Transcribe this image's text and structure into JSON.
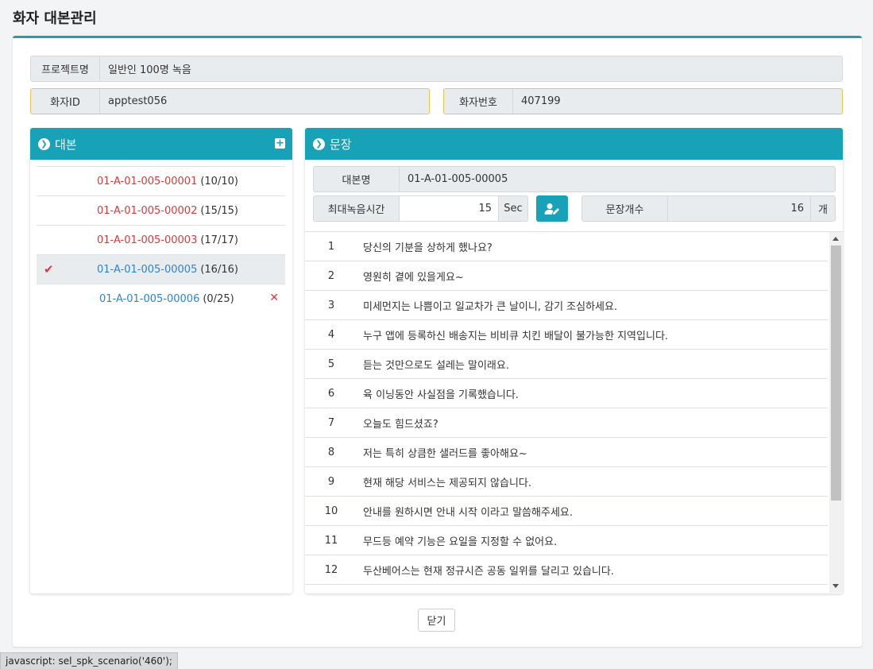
{
  "page": {
    "title": "화자 대본관리"
  },
  "info": {
    "project_label": "프로젝트명",
    "project_value": "일반인 100명 녹음",
    "speaker_id_label": "화자ID",
    "speaker_id_value": "apptest056",
    "speaker_no_label": "화자번호",
    "speaker_no_value": "407199"
  },
  "scripts_panel": {
    "title": "대본",
    "items": [
      {
        "code": "01-A-01-005-00001",
        "count": "(10/10)",
        "color": "red",
        "selected": false,
        "deletable": false
      },
      {
        "code": "01-A-01-005-00002",
        "count": "(15/15)",
        "color": "red",
        "selected": false,
        "deletable": false
      },
      {
        "code": "01-A-01-005-00003",
        "count": "(17/17)",
        "color": "red",
        "selected": false,
        "deletable": false
      },
      {
        "code": "01-A-01-005-00005",
        "count": "(16/16)",
        "color": "blue",
        "selected": true,
        "deletable": false
      },
      {
        "code": "01-A-01-005-00006",
        "count": "(0/25)",
        "color": "blue",
        "selected": false,
        "deletable": true
      }
    ]
  },
  "sentences_panel": {
    "title": "문장",
    "script_name_label": "대본명",
    "script_name_value": "01-A-01-005-00005",
    "max_time_label": "최대녹음시간",
    "max_time_value": "15",
    "max_time_unit": "Sec",
    "sentence_count_label": "문장개수",
    "sentence_count_value": "16",
    "sentence_count_unit": "개",
    "rows": [
      {
        "no": "1",
        "text": "당신의 기분을 상하게 했나요?"
      },
      {
        "no": "2",
        "text": "영원히 곁에 있을게요~"
      },
      {
        "no": "3",
        "text": "미세먼지는 나쁨이고 일교차가 큰 날이니, 감기 조심하세요."
      },
      {
        "no": "4",
        "text": "누구 앱에 등록하신 배송지는 비비큐 치킨 배달이 불가능한 지역입니다."
      },
      {
        "no": "5",
        "text": "듣는 것만으로도 설레는 말이래요."
      },
      {
        "no": "6",
        "text": "육 이닝동안 사실점을 기록했습니다."
      },
      {
        "no": "7",
        "text": "오늘도 힘드셨죠?"
      },
      {
        "no": "8",
        "text": "저는 특히 상큼한 샐러드를 좋아해요~"
      },
      {
        "no": "9",
        "text": "현재 해당 서비스는 제공되지 않습니다."
      },
      {
        "no": "10",
        "text": "안내를 원하시면 안내 시작 이라고 말씀해주세요."
      },
      {
        "no": "11",
        "text": "무드등 예약 기능은 요일을 지정할 수 없어요."
      },
      {
        "no": "12",
        "text": "두산베어스는 현재 정규시즌 공동 일위를 달리고 있습니다."
      }
    ]
  },
  "buttons": {
    "close_label": "닫기"
  },
  "status_bar": {
    "text": "javascript: sel_spk_scenario('460');"
  },
  "colors": {
    "accent": "#18a2b8",
    "red": "#d63b3b",
    "blue": "#2c84d0",
    "highlight_border": "#f0c14b"
  }
}
